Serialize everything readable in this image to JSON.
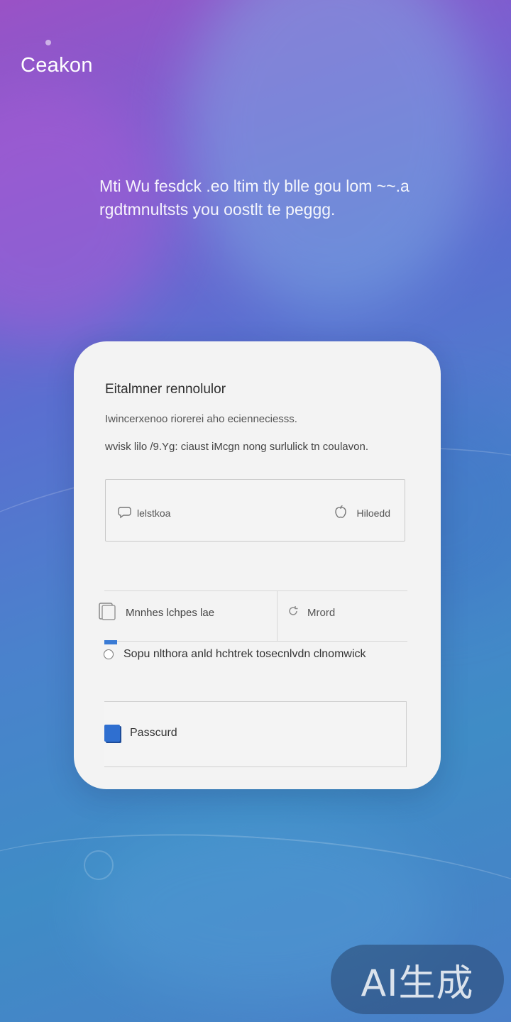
{
  "brand": {
    "name": "Ceakon"
  },
  "hero": {
    "tagline": "Mti Wu fesdck .eo ltim tly blle gou lom ~~.a rgdtmnultsts you oostlt te peggg."
  },
  "card": {
    "title": "Eitalmner rennolulor",
    "subtitle": "Iwincerxenoo riorerei aho ecienneciesss.",
    "detail": "wvisk lilo /9.Yg: ciaust iMcgn nong surlulick tn coulavon.",
    "field": {
      "left_label": "lelstkoa",
      "right_label": "Hiloedd"
    },
    "split": {
      "left_label": "Mnnhes lchpes lae",
      "right_label": "Mrord"
    },
    "radio_label": "Sopu nlthora anld hchtrek tosecnlvdn clnomwick",
    "password_label": "Passcurd"
  },
  "watermark": {
    "text": "AI生成"
  },
  "colors": {
    "accent": "#3a7bd5",
    "card_bg": "#f3f3f3"
  },
  "icons": [
    "chat-bubble-icon",
    "apple-icon",
    "document-icon",
    "refresh-icon",
    "password-icon"
  ]
}
